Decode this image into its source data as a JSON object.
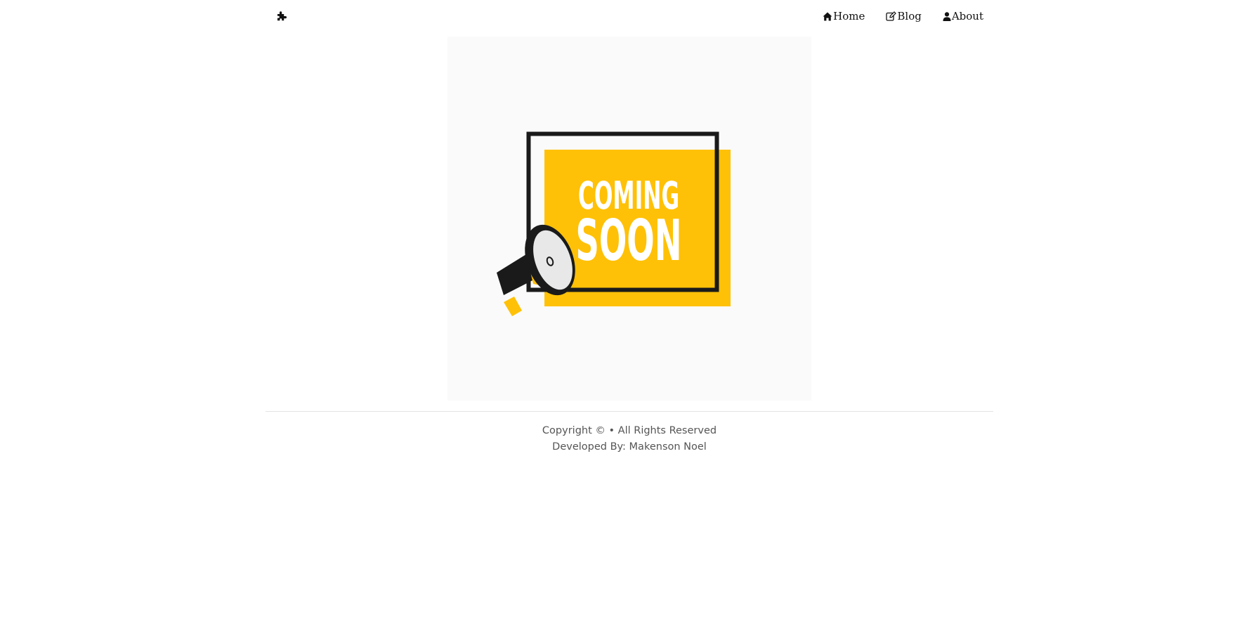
{
  "nav": {
    "brand_icon": "puzzle-piece-icon",
    "links": [
      {
        "label": "Home",
        "icon": "home-icon"
      },
      {
        "label": "Blog",
        "icon": "edit-icon"
      },
      {
        "label": "About",
        "icon": "user-icon"
      }
    ]
  },
  "hero": {
    "line1": "COMING",
    "line2": "SOON",
    "accent": "#FFC107",
    "frame": "#1a1a1a",
    "background": "#fafafa"
  },
  "footer": {
    "copyright": "Copyright © • All Rights Reserved",
    "developer": "Developed By: Makenson Noel"
  }
}
